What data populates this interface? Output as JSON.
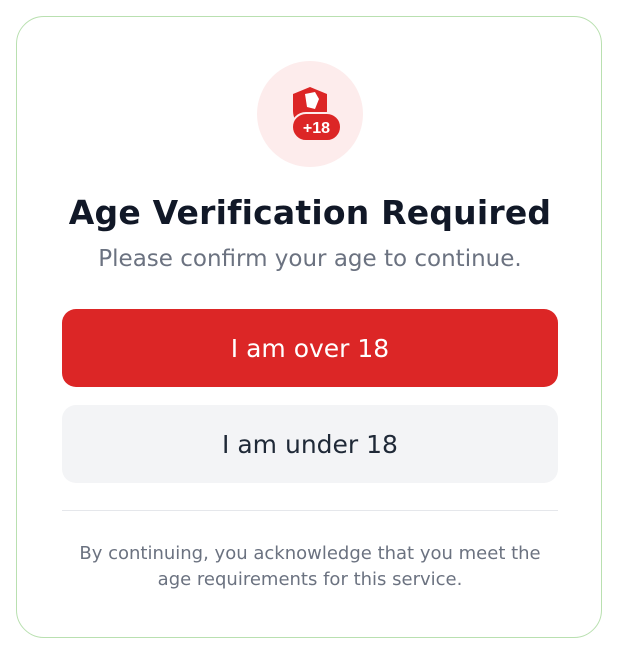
{
  "dialog": {
    "icon": {
      "name": "shield-age-icon",
      "badge_text": "+18"
    },
    "title": "Age Verification Required",
    "subtitle": "Please confirm your age to continue.",
    "primary_button": {
      "label": "I am over 18"
    },
    "secondary_button": {
      "label": "I am under 18"
    },
    "disclaimer_line1": "By continuing, you acknowledge that you meet the",
    "disclaimer_line2": "age requirements for this service."
  },
  "colors": {
    "accent": "#dc2626",
    "icon_background": "#fdecec",
    "title": "#111827",
    "muted_text": "#6b7280",
    "secondary_button_bg": "#f3f4f6"
  }
}
